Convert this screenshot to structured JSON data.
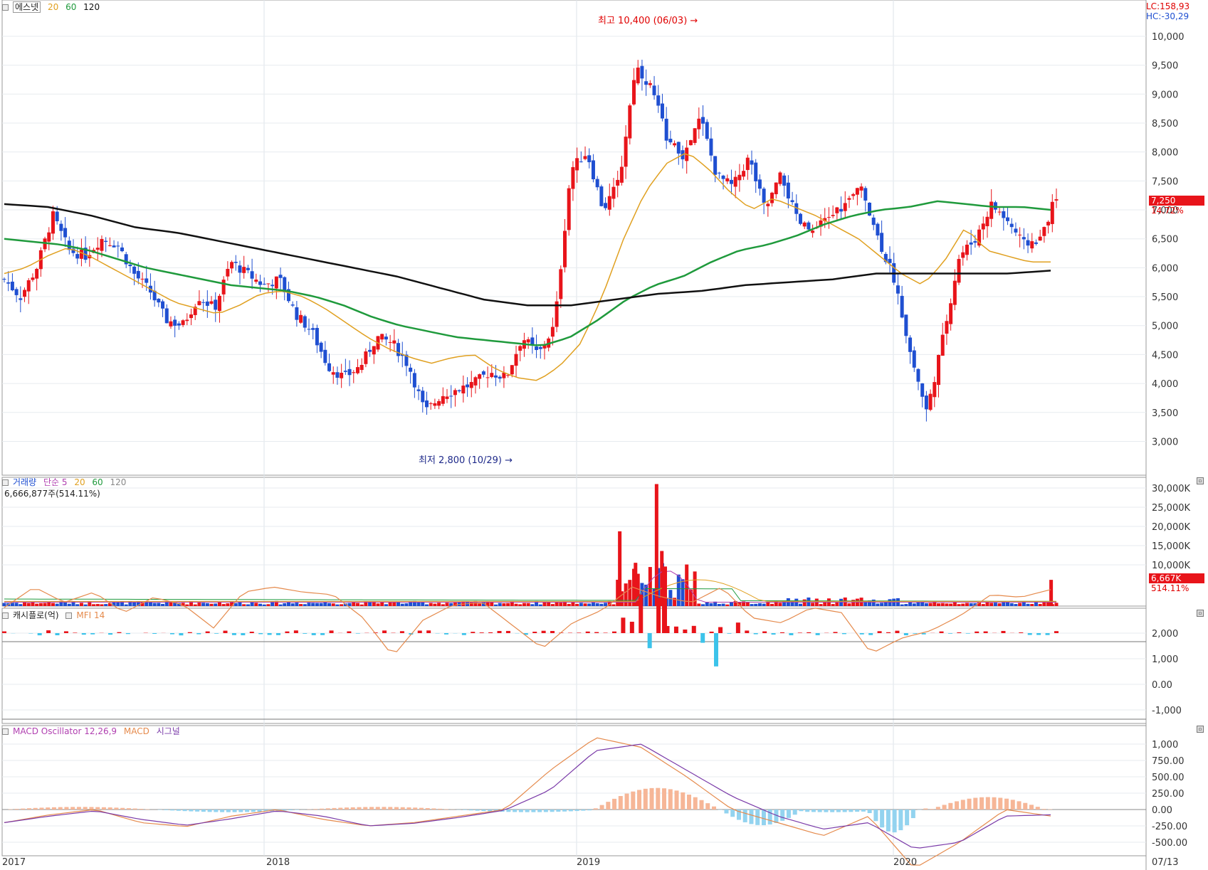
{
  "legend_price": {
    "name": "에스넷",
    "ma20": "20",
    "ma60": "60",
    "ma120": "120"
  },
  "legend_volume": {
    "name": "거래량",
    "type": "단순 5",
    "ma20": "20",
    "ma60": "60",
    "ma120": "120",
    "value": "6,666,877주(514.11%)"
  },
  "legend_mfi": {
    "name": "캐시플로(억)",
    "mfi": "MFI 14"
  },
  "legend_macd": {
    "osc": "MACD Oscillator 12,26,9",
    "macd": "MACD",
    "signal": "시그널"
  },
  "corner": {
    "lc": "LC:158,93",
    "hc": "HC:-30,29"
  },
  "annotations": {
    "high": "최고 10,400 (06/03)",
    "low": "최저 2,800 (10/29)"
  },
  "badges": {
    "price_last": "7,250",
    "price_pct": "14.72%",
    "volume_last": "6,667K",
    "volume_pct": "514.11%"
  },
  "x_labels": [
    "2017",
    "2018",
    "2019",
    "2020",
    "07/13"
  ],
  "colors": {
    "up": "#e8141a",
    "down": "#1f4fd1",
    "ma20": "#e0a020",
    "ma60": "#1f9a3c",
    "ma120": "#111111",
    "mfi": "#e58a4c",
    "macd": "#e58a4c",
    "signal": "#7a3aa8",
    "osc_pos": "#f6b697",
    "osc_neg": "#93d3ef",
    "cf_pos": "#e8141a",
    "cf_neg": "#3cc3ea"
  },
  "chart_data": [
    {
      "type": "candlestick",
      "title": "에스넷",
      "ylim": [
        2600,
        10400
      ],
      "yticks": [
        3000,
        3500,
        4000,
        4500,
        5000,
        5500,
        6000,
        6500,
        7000,
        7500,
        8000,
        8500,
        9000,
        9500,
        10000
      ],
      "ticks_fmt": [
        "3,000",
        "3,500",
        "4,000",
        "4,500",
        "5,000",
        "5,500",
        "6,000",
        "6,500",
        "7,000",
        "7,500",
        "8,000",
        "8,500",
        "9,000",
        "9,500",
        "10,000"
      ],
      "x": [
        "2017",
        "2018",
        "2019",
        "2020",
        "07/13"
      ],
      "close_path": [
        5800,
        5500,
        6000,
        6900,
        6300,
        6200,
        6500,
        6400,
        5900,
        5600,
        5100,
        5000,
        5500,
        5300,
        6100,
        5900,
        5700,
        5800,
        5200,
        4900,
        4300,
        4100,
        4300,
        4800,
        4700,
        4300,
        3500,
        3800,
        3900,
        4000,
        4200,
        4100,
        4800,
        4500,
        5000,
        7700,
        8000,
        7000,
        7500,
        9500,
        9100,
        8200,
        7900,
        8600,
        7600,
        7400,
        7900,
        7000,
        7600,
        6800,
        6600,
        6900,
        7100,
        7400,
        6500,
        5800,
        4500,
        3500,
        4800,
        6200,
        6500,
        7100,
        6800,
        6400,
        6500,
        7250
      ],
      "ma20_path": [
        5900,
        6000,
        6200,
        6350,
        6200,
        6000,
        5800,
        5600,
        5400,
        5300,
        5200,
        5350,
        5550,
        5600,
        5500,
        5300,
        5050,
        4800,
        4600,
        4450,
        4350,
        4450,
        4500,
        4250,
        4100,
        4050,
        4300,
        4700,
        5500,
        6500,
        7300,
        7800,
        8000,
        7700,
        7300,
        7000,
        7200,
        7050,
        6900,
        6700,
        6500,
        6200,
        5900,
        5700,
        6100,
        6700,
        6300,
        6200,
        6100,
        6100
      ],
      "ma60_path": [
        6500,
        6450,
        6400,
        6300,
        6150,
        6000,
        5900,
        5800,
        5700,
        5650,
        5600,
        5500,
        5350,
        5150,
        5000,
        4900,
        4800,
        4750,
        4700,
        4650,
        4800,
        5100,
        5450,
        5700,
        5850,
        6100,
        6300,
        6400,
        6550,
        6750,
        6900,
        7000,
        7050,
        7150,
        7100,
        7050,
        7050,
        7000
      ],
      "ma120_path": [
        7100,
        7050,
        6900,
        6700,
        6600,
        6450,
        6300,
        6150,
        6000,
        5850,
        5650,
        5450,
        5350,
        5350,
        5450,
        5550,
        5600,
        5700,
        5750,
        5800,
        5900,
        5900,
        5900,
        5900,
        5950
      ],
      "volume_max": 30000,
      "volume_ticks": [
        "30,000K",
        "25,000K",
        "20,000K",
        "15,000K",
        "10,000K"
      ],
      "volume_spikes": [
        {
          "x": "2019-04",
          "value": 19000
        },
        {
          "x": "2019-06",
          "value": 31000
        },
        {
          "x": "2019-07",
          "value": 14000
        },
        {
          "x": "2020-07",
          "value": 6667
        }
      ],
      "mfi_ticks": [
        "2,000",
        "1,000",
        "0.00",
        "-1,000"
      ],
      "macd_ticks": [
        "1,000",
        "750.00",
        "500.00",
        "250.00",
        "0.00",
        "-250.00",
        "-500.00"
      ]
    }
  ]
}
